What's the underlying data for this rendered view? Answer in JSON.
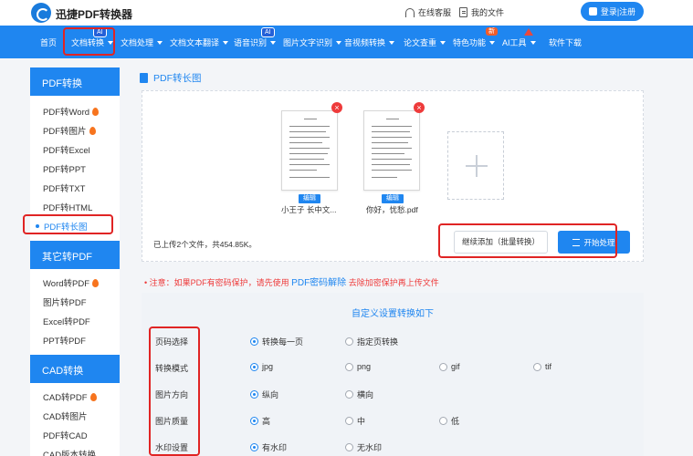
{
  "header": {
    "brand": "迅捷PDF转换器",
    "service": "在线客服",
    "my_files": "我的文件",
    "login": "登录|注册"
  },
  "nav": {
    "items": [
      "首页",
      "文档转换",
      "文档处理",
      "文档文本翻译",
      "语音识别",
      "图片文字识别",
      "音视频转换",
      "论文查重",
      "特色功能",
      "AI工具",
      "软件下载"
    ],
    "badge_ai": "AI",
    "badge_new": "新"
  },
  "sidebar": {
    "groups": [
      {
        "title": "PDF转换",
        "items": [
          "PDF转Word",
          "PDF转图片",
          "PDF转Excel",
          "PDF转PPT",
          "PDF转TXT",
          "PDF转HTML",
          "PDF转长图"
        ]
      },
      {
        "title": "其它转PDF",
        "items": [
          "Word转PDF",
          "图片转PDF",
          "Excel转PDF",
          "PPT转PDF"
        ]
      },
      {
        "title": "CAD转换",
        "items": [
          "CAD转PDF",
          "CAD转图片",
          "PDF转CAD",
          "CAD版本转换"
        ]
      }
    ]
  },
  "main": {
    "title": "PDF转长图",
    "files": [
      {
        "name": "小王子 长中文...",
        "edit": "编辑"
      },
      {
        "name": "你好，忧愁.pdf",
        "edit": "编辑"
      }
    ],
    "summary": "已上传2个文件，共454.85K。",
    "continue_btn": "继续添加（批量转换）",
    "start_btn": "开始处理",
    "notice_prefix": "•  注意：如果PDF有密码保护，请先使用",
    "notice_link": "PDF密码解除",
    "notice_suffix": "去除加密保护再上传文件"
  },
  "settings": {
    "title": "自定义设置转换如下",
    "rows": [
      {
        "label": "页码选择",
        "options": [
          "转换每一页",
          "指定页转换"
        ]
      },
      {
        "label": "转换模式",
        "options": [
          "jpg",
          "png",
          "gif",
          "tif"
        ]
      },
      {
        "label": "图片方向",
        "options": [
          "纵向",
          "横向"
        ]
      },
      {
        "label": "图片质量",
        "options": [
          "高",
          "中",
          "低"
        ]
      },
      {
        "label": "水印设置",
        "options": [
          "有水印",
          "无水印"
        ]
      }
    ]
  },
  "colors": {
    "accent": "#1f86f0",
    "highlight": "#e02424",
    "hot": "#f7741e"
  }
}
